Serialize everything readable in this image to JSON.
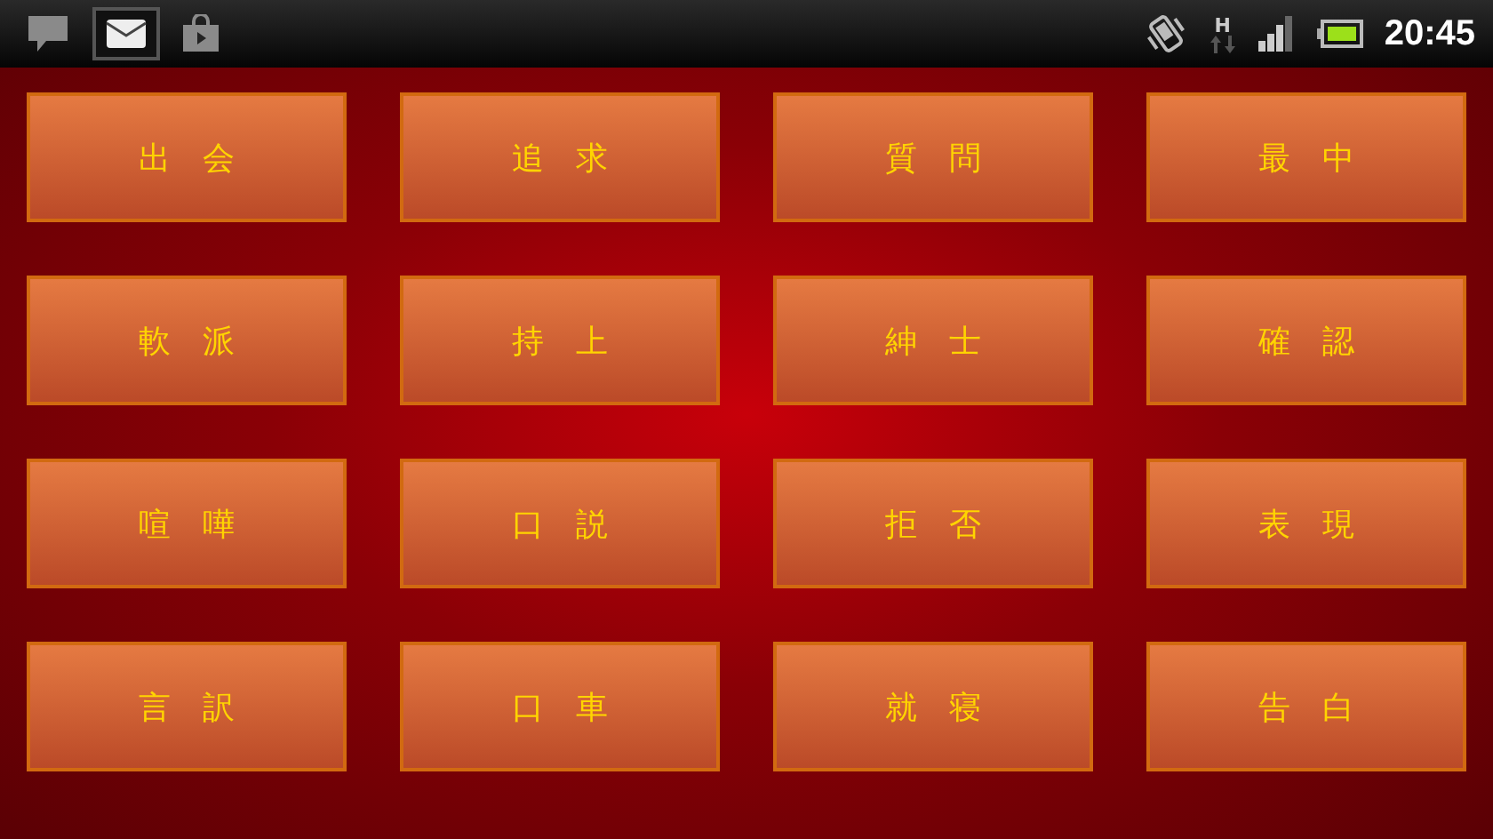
{
  "status_bar": {
    "time": "20:45",
    "network_type": "H"
  },
  "buttons": [
    {
      "label": "出　会"
    },
    {
      "label": "追　求"
    },
    {
      "label": "質　問"
    },
    {
      "label": "最　中"
    },
    {
      "label": "軟　派"
    },
    {
      "label": "持　上"
    },
    {
      "label": "紳　士"
    },
    {
      "label": "確　認"
    },
    {
      "label": "喧　嘩"
    },
    {
      "label": "口　説"
    },
    {
      "label": "拒　否"
    },
    {
      "label": "表　現"
    },
    {
      "label": "言　訳"
    },
    {
      "label": "口　車"
    },
    {
      "label": "就　寝"
    },
    {
      "label": "告　白"
    }
  ]
}
